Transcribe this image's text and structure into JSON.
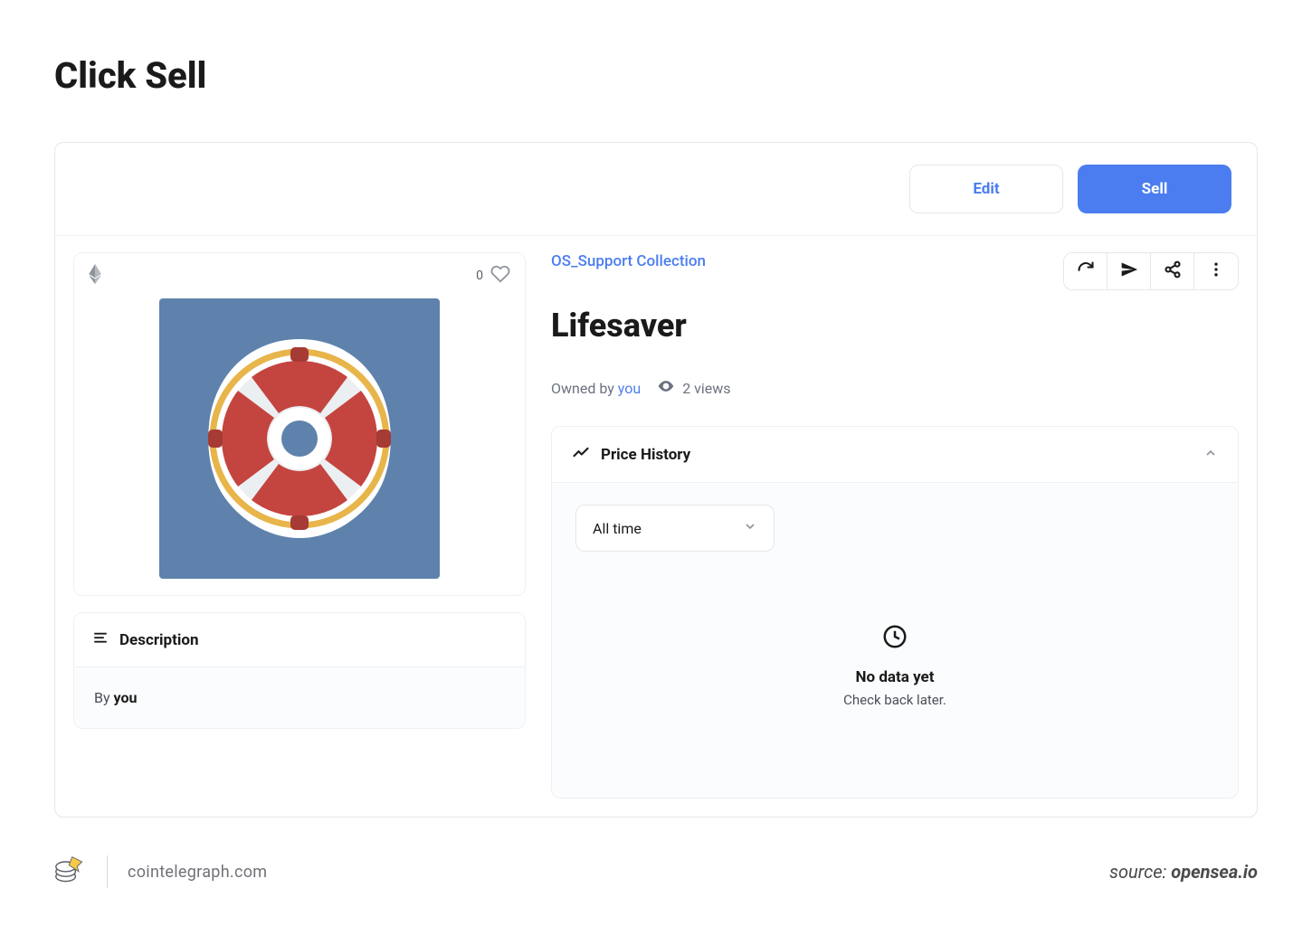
{
  "heading": "Click Sell",
  "toolbar": {
    "edit_label": "Edit",
    "sell_label": "Sell"
  },
  "media": {
    "fav_count": "0"
  },
  "description": {
    "header": "Description",
    "by_prefix": "By ",
    "by_who": "you"
  },
  "nft": {
    "collection": "OS_Support Collection",
    "title": "Lifesaver",
    "owned_prefix": "Owned by ",
    "owner": "you",
    "views": "2 views"
  },
  "price_history": {
    "header": "Price History",
    "dropdown_selected": "All time",
    "empty_title": "No data yet",
    "empty_sub": "Check back later."
  },
  "footer": {
    "brand": "cointelegraph.com",
    "source_prefix": "source: ",
    "source_value": "opensea.io"
  }
}
